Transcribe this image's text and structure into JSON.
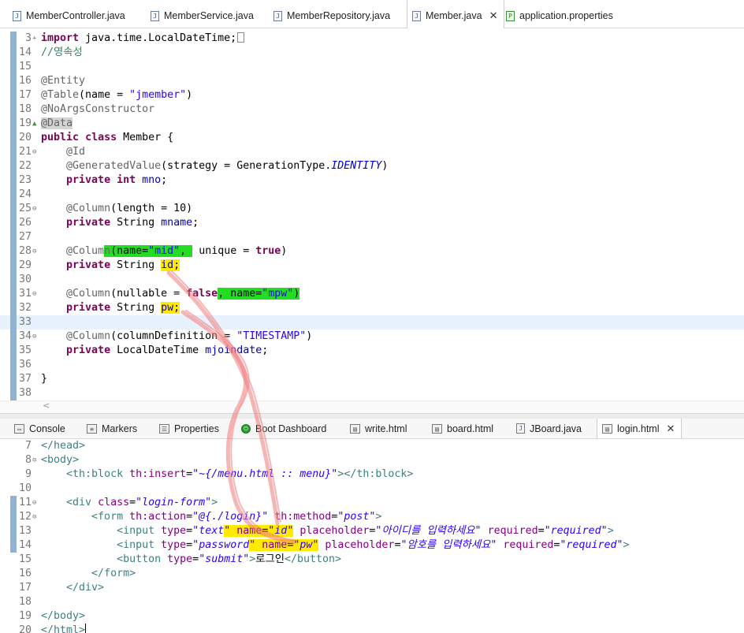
{
  "top_tabs": [
    {
      "label": "MemberController.java",
      "icon": "java-file-icon",
      "active": false
    },
    {
      "label": "MemberService.java",
      "icon": "java-file-icon",
      "active": false
    },
    {
      "label": "MemberRepository.java",
      "icon": "java-file-icon",
      "active": false
    },
    {
      "label": "Member.java",
      "icon": "java-file-icon",
      "active": true
    },
    {
      "label": "application.properties",
      "icon": "properties-file-icon",
      "active": false
    }
  ],
  "bottom_tabs": [
    {
      "label": "Console",
      "icon": "console-icon",
      "active": false
    },
    {
      "label": "Markers",
      "icon": "markers-icon",
      "active": false
    },
    {
      "label": "Properties",
      "icon": "properties-view-icon",
      "active": false
    },
    {
      "label": "Boot Dashboard",
      "icon": "boot-dashboard-icon",
      "active": false
    },
    {
      "label": "write.html",
      "icon": "html-file-icon",
      "active": false
    },
    {
      "label": "board.html",
      "icon": "html-file-icon",
      "active": false
    },
    {
      "label": "JBoard.java",
      "icon": "java-file-icon",
      "active": false
    },
    {
      "label": "login.html",
      "icon": "html-file-icon",
      "active": true
    }
  ],
  "java_lines": [
    {
      "n": "3",
      "fold": "+",
      "tokens": [
        [
          "kw",
          "import"
        ],
        [
          "t",
          " java.time.LocalDateTime;"
        ]
      ],
      "box": true
    },
    {
      "n": "14",
      "tokens": [
        [
          "cm",
          "//영속성"
        ]
      ]
    },
    {
      "n": "15",
      "tokens": []
    },
    {
      "n": "16",
      "tokens": [
        [
          "an",
          "@Entity"
        ]
      ]
    },
    {
      "n": "17",
      "tokens": [
        [
          "an",
          "@Table"
        ],
        [
          "t",
          "(name = "
        ],
        [
          "str",
          "\"jmember\""
        ],
        [
          "t",
          ")"
        ]
      ]
    },
    {
      "n": "18",
      "tokens": [
        [
          "an",
          "@NoArgsConstructor"
        ]
      ]
    },
    {
      "n": "19",
      "fold": "▲",
      "foldClass": "warn",
      "tokens": [
        [
          "an-bg",
          "@Data"
        ]
      ]
    },
    {
      "n": "20",
      "tokens": [
        [
          "kw",
          "public"
        ],
        [
          "t",
          " "
        ],
        [
          "kw",
          "class"
        ],
        [
          "t",
          " Member {"
        ]
      ]
    },
    {
      "n": "21",
      "fold": "⊖",
      "tokens": [
        [
          "t",
          "    "
        ],
        [
          "an",
          "@Id"
        ]
      ]
    },
    {
      "n": "22",
      "tokens": [
        [
          "t",
          "    "
        ],
        [
          "an",
          "@GeneratedValue"
        ],
        [
          "t",
          "(strategy = GenerationType."
        ],
        [
          "sfld",
          "IDENTITY"
        ],
        [
          "t",
          ")"
        ]
      ]
    },
    {
      "n": "23",
      "tokens": [
        [
          "t",
          "    "
        ],
        [
          "kw",
          "private"
        ],
        [
          "t",
          " "
        ],
        [
          "kw",
          "int"
        ],
        [
          "t",
          " "
        ],
        [
          "fld",
          "mno"
        ],
        [
          "t",
          ";"
        ]
      ]
    },
    {
      "n": "24",
      "tokens": []
    },
    {
      "n": "25",
      "fold": "⊖",
      "tokens": [
        [
          "t",
          "    "
        ],
        [
          "an",
          "@Column"
        ],
        [
          "t",
          "(length = 10)"
        ]
      ]
    },
    {
      "n": "26",
      "tokens": [
        [
          "t",
          "    "
        ],
        [
          "kw",
          "private"
        ],
        [
          "t",
          " String "
        ],
        [
          "fld",
          "mname"
        ],
        [
          "t",
          ";"
        ]
      ]
    },
    {
      "n": "27",
      "tokens": []
    },
    {
      "n": "28",
      "fold": "⊖",
      "tokens": [
        [
          "t",
          "    "
        ],
        [
          "an",
          "@Colum"
        ],
        [
          "an hl-g",
          "n"
        ],
        [
          "t hl-g",
          "(name="
        ],
        [
          "str hl-g",
          "\"mid\""
        ],
        [
          "t hl-g",
          ", "
        ],
        [
          "t",
          " unique = "
        ],
        [
          "kw",
          "true"
        ],
        [
          "t",
          ")"
        ]
      ]
    },
    {
      "n": "29",
      "tokens": [
        [
          "t",
          "    "
        ],
        [
          "kw",
          "private"
        ],
        [
          "t",
          " String "
        ],
        [
          "fld hl-y",
          "id"
        ],
        [
          "t hl-y",
          ";"
        ]
      ]
    },
    {
      "n": "30",
      "tokens": []
    },
    {
      "n": "31",
      "fold": "⊖",
      "tokens": [
        [
          "t",
          "    "
        ],
        [
          "an",
          "@Column"
        ],
        [
          "t",
          "(nullable = "
        ],
        [
          "kw",
          "false"
        ],
        [
          "t hl-g",
          ", name="
        ],
        [
          "str hl-g",
          "\"mpw\""
        ],
        [
          "t hl-g",
          ")"
        ]
      ]
    },
    {
      "n": "32",
      "tokens": [
        [
          "t",
          "    "
        ],
        [
          "kw",
          "private"
        ],
        [
          "t",
          " String "
        ],
        [
          "fld hl-y",
          "pw"
        ],
        [
          "t hl-y",
          ";"
        ]
      ]
    },
    {
      "n": "33",
      "cur": true,
      "tokens": []
    },
    {
      "n": "34",
      "fold": "⊖",
      "tokens": [
        [
          "t",
          "    "
        ],
        [
          "an",
          "@Column"
        ],
        [
          "t",
          "(columnDefinition = "
        ],
        [
          "str",
          "\"TIMESTAMP\""
        ],
        [
          "t",
          ")"
        ]
      ]
    },
    {
      "n": "35",
      "tokens": [
        [
          "t",
          "    "
        ],
        [
          "kw",
          "private"
        ],
        [
          "t",
          " LocalDateTime "
        ],
        [
          "fld",
          "mjoindate"
        ],
        [
          "t",
          ";"
        ]
      ]
    },
    {
      "n": "36",
      "tokens": []
    },
    {
      "n": "37",
      "tokens": [
        [
          "t",
          "}"
        ]
      ]
    },
    {
      "n": "38",
      "tokens": []
    }
  ],
  "html_lines": [
    {
      "n": "7",
      "tokens": [
        [
          "tag",
          "</head>"
        ]
      ]
    },
    {
      "n": "8",
      "fold": "⊖",
      "tokens": [
        [
          "tag",
          "<body>"
        ]
      ]
    },
    {
      "n": "9",
      "tokens": [
        [
          "t",
          "    "
        ],
        [
          "tag",
          "<th:block"
        ],
        [
          "t",
          " "
        ],
        [
          "attr",
          "th:insert"
        ],
        [
          "t",
          "="
        ],
        [
          "aval",
          "\"~{/menu.html :: menu}\""
        ],
        [
          "tag",
          "></th:block>"
        ]
      ]
    },
    {
      "n": "10",
      "tokens": []
    },
    {
      "n": "11",
      "fold": "⊖",
      "tokens": [
        [
          "t",
          "    "
        ],
        [
          "tag",
          "<div"
        ],
        [
          "t",
          " "
        ],
        [
          "attr",
          "class"
        ],
        [
          "t",
          "="
        ],
        [
          "aval",
          "\"login-form\""
        ],
        [
          "tag",
          ">"
        ]
      ]
    },
    {
      "n": "12",
      "fold": "⊖",
      "tokens": [
        [
          "t",
          "        "
        ],
        [
          "tag",
          "<form"
        ],
        [
          "t",
          " "
        ],
        [
          "attr",
          "th:action"
        ],
        [
          "t",
          "="
        ],
        [
          "aval",
          "\"@{./login}\""
        ],
        [
          "t",
          " "
        ],
        [
          "attr",
          "th:method"
        ],
        [
          "t",
          "="
        ],
        [
          "aval",
          "\"post\""
        ],
        [
          "tag",
          ">"
        ]
      ]
    },
    {
      "n": "13",
      "tokens": [
        [
          "t",
          "            "
        ],
        [
          "tag",
          "<input"
        ],
        [
          "t",
          " "
        ],
        [
          "attr",
          "type"
        ],
        [
          "t",
          "="
        ],
        [
          "aval",
          "\"text"
        ],
        [
          "aval hl-y",
          "\""
        ],
        [
          "t hl-y",
          " "
        ],
        [
          "attr hl-y",
          "name"
        ],
        [
          "t hl-y",
          "="
        ],
        [
          "aval hl-y",
          "\"id\""
        ],
        [
          "t",
          " "
        ],
        [
          "attr",
          "placeholder"
        ],
        [
          "t",
          "="
        ],
        [
          "aval",
          "\"아이디를 입력하세요\""
        ],
        [
          "t",
          " "
        ],
        [
          "attr",
          "required"
        ],
        [
          "t",
          "="
        ],
        [
          "aval",
          "\"required\""
        ],
        [
          "tag",
          ">"
        ]
      ]
    },
    {
      "n": "14",
      "tokens": [
        [
          "t",
          "            "
        ],
        [
          "tag",
          "<input"
        ],
        [
          "t",
          " "
        ],
        [
          "attr",
          "type"
        ],
        [
          "t",
          "="
        ],
        [
          "aval",
          "\"password"
        ],
        [
          "aval hl-y",
          "\""
        ],
        [
          "t hl-y",
          " "
        ],
        [
          "attr hl-y",
          "name"
        ],
        [
          "t hl-y",
          "="
        ],
        [
          "aval hl-y",
          "\"pw\""
        ],
        [
          "t",
          " "
        ],
        [
          "attr",
          "placeholder"
        ],
        [
          "t",
          "="
        ],
        [
          "aval",
          "\"암호를 입력하세요\""
        ],
        [
          "t",
          " "
        ],
        [
          "attr",
          "required"
        ],
        [
          "t",
          "="
        ],
        [
          "aval",
          "\"required\""
        ],
        [
          "tag",
          ">"
        ]
      ]
    },
    {
      "n": "15",
      "tokens": [
        [
          "t",
          "            "
        ],
        [
          "tag",
          "<button"
        ],
        [
          "t",
          " "
        ],
        [
          "attr",
          "type"
        ],
        [
          "t",
          "="
        ],
        [
          "aval",
          "\"submit\""
        ],
        [
          "tag",
          ">"
        ],
        [
          "t",
          "로그인"
        ],
        [
          "tag",
          "</button>"
        ]
      ]
    },
    {
      "n": "16",
      "tokens": [
        [
          "t",
          "        "
        ],
        [
          "tag",
          "</form>"
        ]
      ]
    },
    {
      "n": "17",
      "tokens": [
        [
          "t",
          "    "
        ],
        [
          "tag",
          "</div>"
        ]
      ]
    },
    {
      "n": "18",
      "tokens": []
    },
    {
      "n": "19",
      "tokens": [
        [
          "tag",
          "</body>"
        ]
      ]
    },
    {
      "n": "20",
      "caret": true,
      "tokens": [
        [
          "tag",
          "</html>"
        ]
      ]
    }
  ],
  "hscroll_glyph": "<"
}
